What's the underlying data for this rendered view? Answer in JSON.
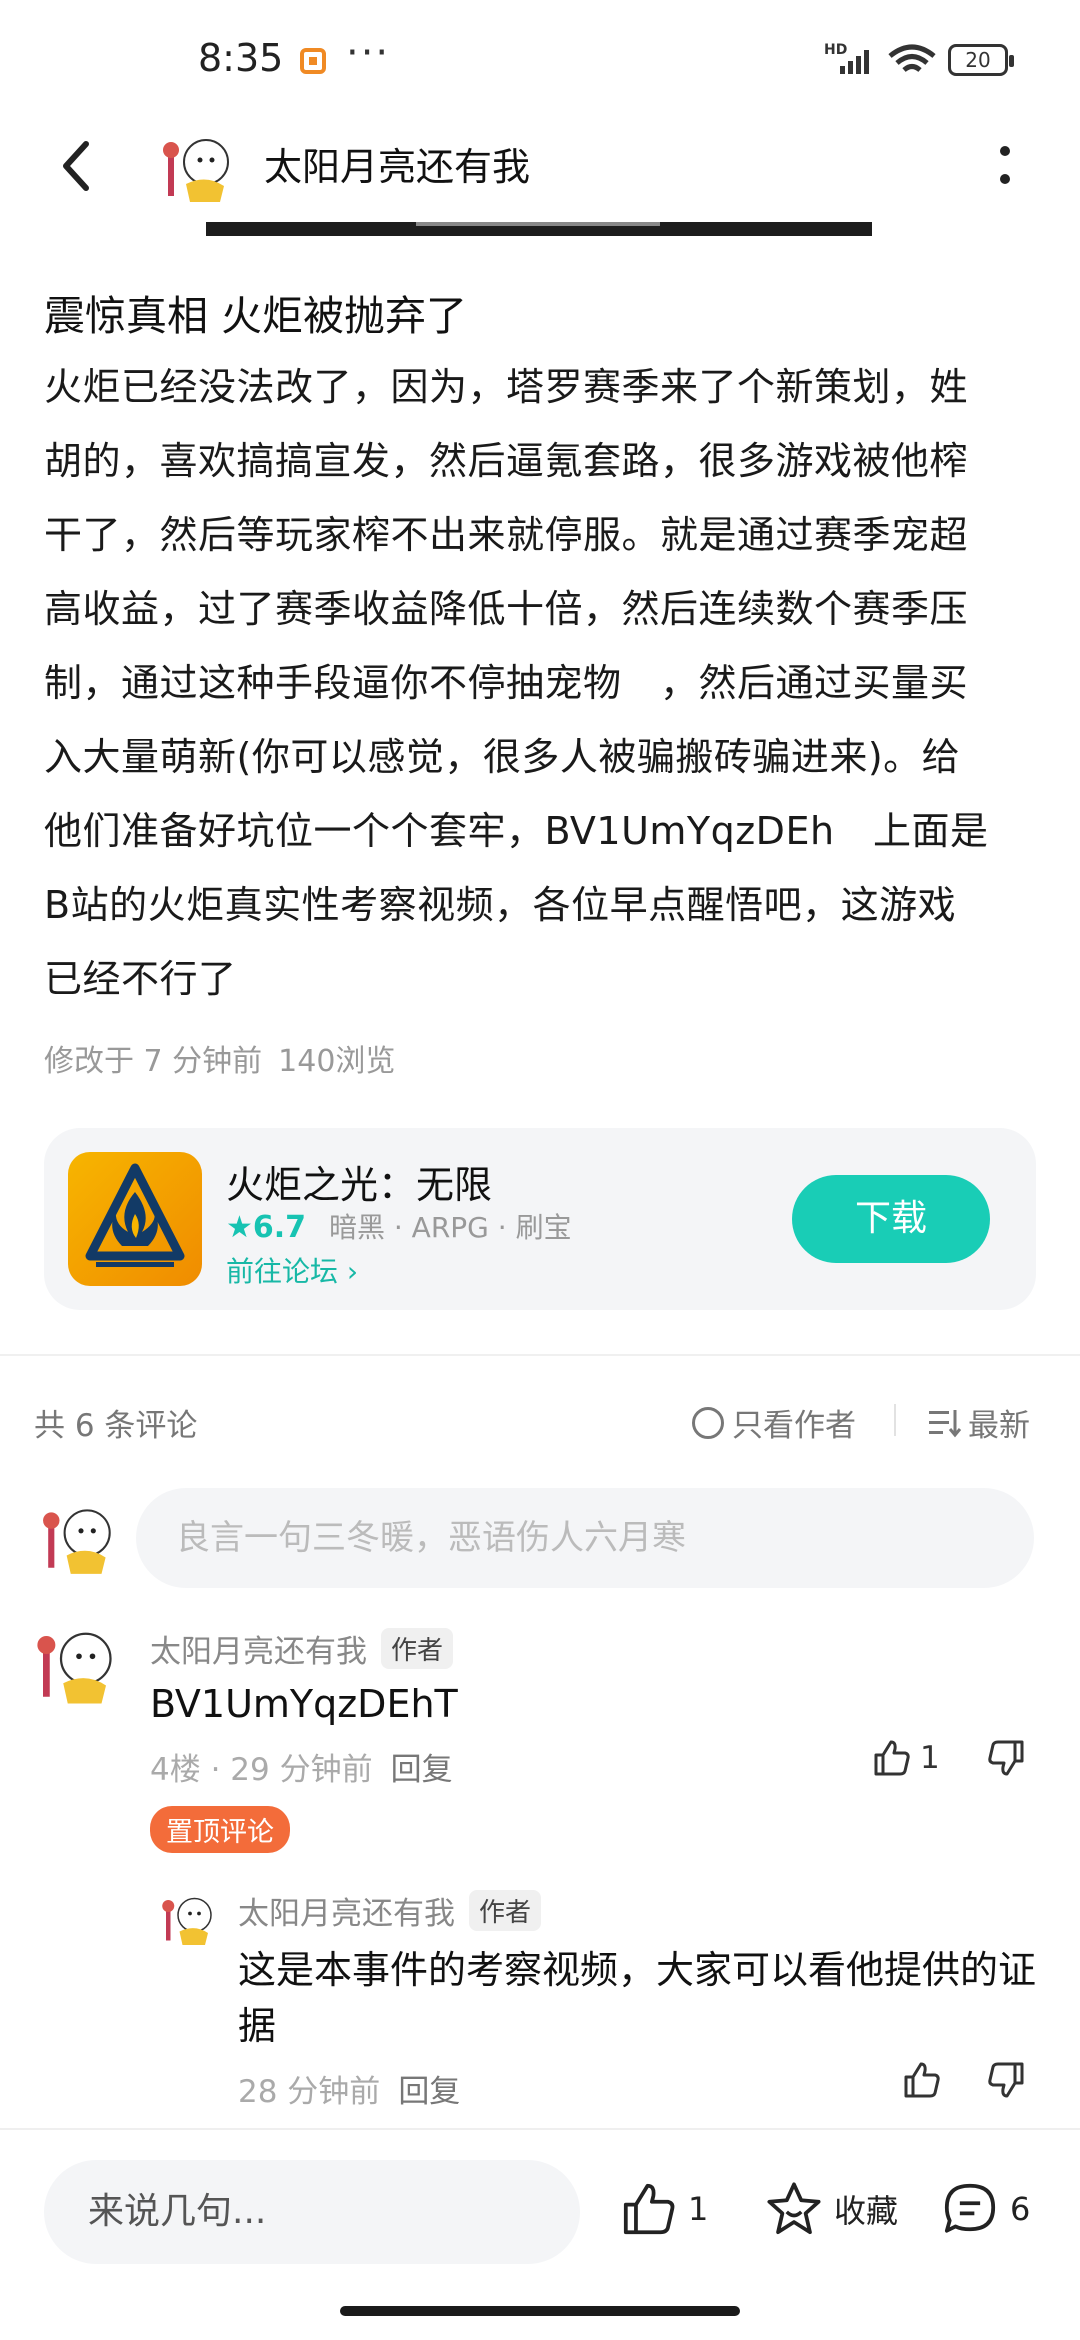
{
  "status_bar": {
    "time": "8:35",
    "dots": "···",
    "hd": "HD",
    "battery": "20"
  },
  "header": {
    "title": "太阳月亮还有我"
  },
  "post": {
    "title": "震惊真相 火炬被抛弃了",
    "lines": [
      "火炬已经没法改了，因为，塔罗赛季来了个新策划，姓",
      "胡的，喜欢搞搞宣发，然后逼氪套路，很多游戏被他榨",
      "干了，然后等玩家榨不出来就停服。就是通过赛季宠超",
      "高收益，过了赛季收益降低十倍，然后连续数个赛季压",
      "制，通过这种手段逼你不停抽宠物　，然后通过买量买",
      "入大量萌新(你可以感觉，很多人被骗搬砖骗进来)。给",
      "他们准备好坑位一个个套牢，BV1UmYqzDEh　上面是",
      "B站的火炬真实性考察视频，各位早点醒悟吧，这游戏",
      "已经不行了"
    ],
    "modified": "修改于 7 分钟前",
    "views": "140浏览"
  },
  "game_card": {
    "name": "火炬之光：无限",
    "score": "6.7",
    "tags": "暗黑 · ARPG · 刷宝",
    "forum_link": "前往论坛",
    "download_label": "下载"
  },
  "comments": {
    "count_label": "共 6 条评论",
    "only_author_label": "只看作者",
    "sort_label": "最新",
    "input_placeholder": "良言一句三冬暖，恶语伤人六月寒",
    "items": [
      {
        "user": "太阳月亮还有我",
        "tag": "作者",
        "text": "BV1UmYqzDEhT",
        "meta": "4楼 · 29 分钟前",
        "reply_label": "回复",
        "likes": "1",
        "pinned_label": "置顶评论"
      }
    ],
    "reply": {
      "user": "太阳月亮还有我",
      "tag": "作者",
      "text": "这是本事件的考察视频，大家可以看他提供的证据",
      "meta": "28 分钟前",
      "reply_label": "回复"
    }
  },
  "bottom_bar": {
    "input_placeholder": "来说几句...",
    "likes": "1",
    "favorite_label": "收藏",
    "comments": "6"
  },
  "colors": {
    "accent": "#19cdb6",
    "pinned": "#f36c3a",
    "game_icon": "#f7b500"
  }
}
